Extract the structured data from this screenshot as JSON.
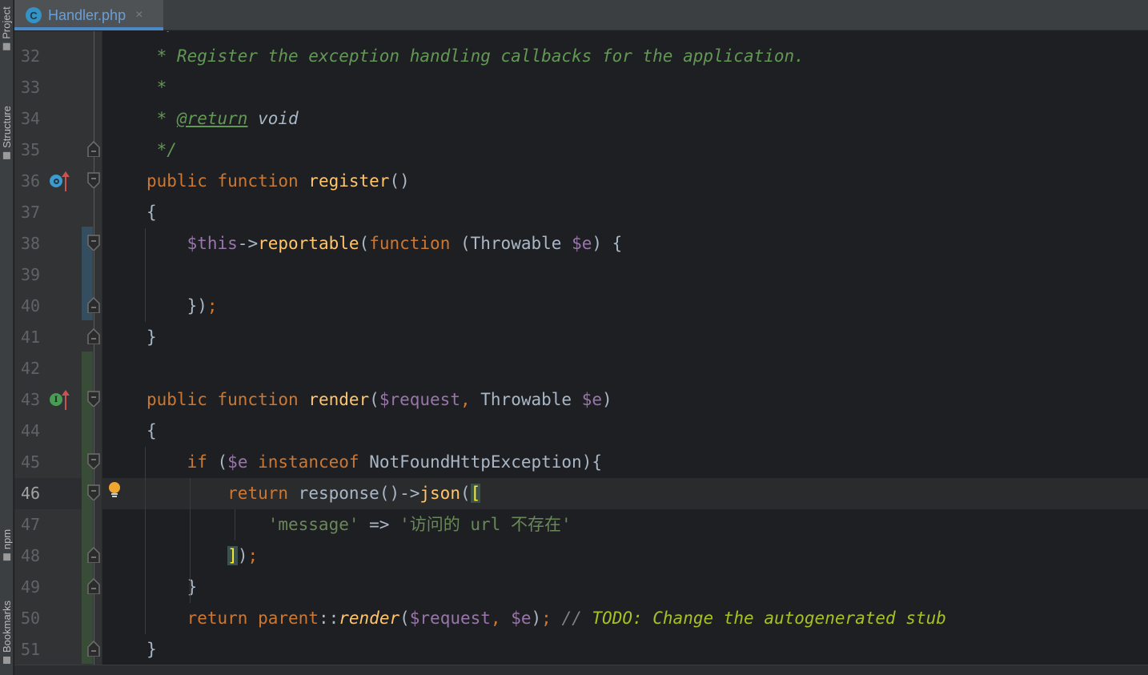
{
  "toolwindows": {
    "project": "Project",
    "structure": "Structure",
    "npm": "npm",
    "bookmarks": "Bookmarks"
  },
  "tabs": [
    {
      "title": "Handler.php",
      "icon": "php-class-icon",
      "active": true,
      "close": "×",
      "icon_letter": "C"
    }
  ],
  "colors": {
    "tab_accent": "#4a88c7",
    "keyword": "#cc7832",
    "function": "#ffc66d",
    "variable": "#9876aa",
    "string": "#6a8759",
    "doc_comment": "#629755",
    "todo": "#a8c023",
    "git_modified": "#344d5f",
    "git_added": "#384c38"
  },
  "editor": {
    "current_line": 46,
    "lines": [
      {
        "n": "32",
        "tokens": [
          [
            "cm",
            " * Register the exception handling callbacks for the application."
          ]
        ]
      },
      {
        "n": "33",
        "tokens": [
          [
            "cm",
            " *"
          ]
        ]
      },
      {
        "n": "34",
        "tokens": [
          [
            "cm",
            " * "
          ],
          [
            "cmu",
            "@return"
          ],
          [
            "plain",
            " "
          ],
          [
            "cmt",
            "void"
          ]
        ]
      },
      {
        "n": "35",
        "tokens": [
          [
            "cm",
            " */"
          ]
        ]
      },
      {
        "n": "36",
        "tokens": [
          [
            "kw",
            "public function "
          ],
          [
            "fn",
            "register"
          ],
          [
            "plain",
            "()"
          ]
        ]
      },
      {
        "n": "37",
        "tokens": [
          [
            "plain",
            "{"
          ]
        ]
      },
      {
        "n": "38",
        "tokens": [
          [
            "plain",
            "    "
          ],
          [
            "var",
            "$this"
          ],
          [
            "plain",
            "->"
          ],
          [
            "fn",
            "reportable"
          ],
          [
            "plain",
            "("
          ],
          [
            "kw",
            "function "
          ],
          [
            "plain",
            "(Throwable "
          ],
          [
            "var",
            "$e"
          ],
          [
            "plain",
            ") {"
          ]
        ]
      },
      {
        "n": "39",
        "tokens": []
      },
      {
        "n": "40",
        "tokens": [
          [
            "plain",
            "    });"
          ],
          [
            "kw",
            ""
          ]
        ]
      },
      {
        "n": "41",
        "tokens": [
          [
            "plain",
            "}"
          ]
        ]
      },
      {
        "n": "42",
        "tokens": []
      },
      {
        "n": "43",
        "tokens": [
          [
            "kw",
            "public function "
          ],
          [
            "fn",
            "render"
          ],
          [
            "plain",
            "("
          ],
          [
            "var",
            "$request"
          ],
          [
            "kw",
            ", "
          ],
          [
            "plain",
            "Throwable "
          ],
          [
            "var",
            "$e"
          ],
          [
            "plain",
            ")"
          ]
        ]
      },
      {
        "n": "44",
        "tokens": [
          [
            "plain",
            "{"
          ]
        ]
      },
      {
        "n": "45",
        "tokens": [
          [
            "plain",
            "    "
          ],
          [
            "kw",
            "if "
          ],
          [
            "plain",
            "("
          ],
          [
            "var",
            "$e "
          ],
          [
            "kw",
            "instanceof "
          ],
          [
            "plain",
            "NotFoundHttpException){"
          ]
        ]
      },
      {
        "n": "46",
        "tokens": [
          [
            "plain",
            "        "
          ],
          [
            "kw",
            "return "
          ],
          [
            "plain",
            "response()->"
          ],
          [
            "fn",
            "json"
          ],
          [
            "plain",
            "("
          ],
          [
            "brk",
            "["
          ]
        ]
      },
      {
        "n": "47",
        "tokens": [
          [
            "plain",
            "            "
          ],
          [
            "str",
            "'message'"
          ],
          [
            "plain",
            " => "
          ],
          [
            "str",
            "'访问的 url 不存在'"
          ]
        ]
      },
      {
        "n": "48",
        "tokens": [
          [
            "plain",
            "        "
          ],
          [
            "brk",
            "]"
          ],
          [
            "plain",
            ")"
          ],
          [
            "kw",
            ";"
          ]
        ]
      },
      {
        "n": "49",
        "tokens": [
          [
            "plain",
            "    }"
          ]
        ]
      },
      {
        "n": "50",
        "tokens": [
          [
            "plain",
            "    "
          ],
          [
            "kw",
            "return parent"
          ],
          [
            "plain",
            "::"
          ],
          [
            "fni",
            "render"
          ],
          [
            "plain",
            "("
          ],
          [
            "var",
            "$request"
          ],
          [
            "kw",
            ", "
          ],
          [
            "var",
            "$e"
          ],
          [
            "plain",
            ")"
          ],
          [
            "kw",
            "; "
          ],
          [
            "lc",
            "// "
          ],
          [
            "todo",
            "TODO: Change the autogenerated stub"
          ]
        ]
      },
      {
        "n": "51",
        "tokens": [
          [
            "plain",
            "}"
          ]
        ]
      }
    ]
  },
  "gutter_icons": {
    "36": [
      "implements-icon",
      "override-up-arrow-icon"
    ],
    "43": [
      "implements-interface-icon",
      "override-up-arrow-icon"
    ],
    "46": [
      "intention-bulb-icon"
    ]
  }
}
